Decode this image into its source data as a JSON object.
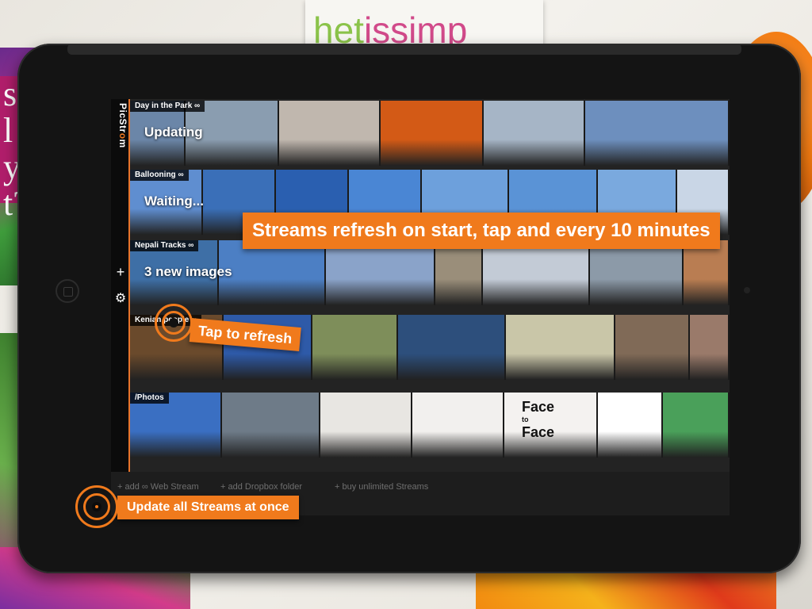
{
  "desk": {
    "card_text_a": "het",
    "card_text_b": "issimp",
    "book_text": "s\nl\ny\nt?"
  },
  "app": {
    "logo_prefix": "PicStr",
    "logo_o": "o",
    "logo_suffix": "m",
    "add_icon": "+",
    "settings_icon": "⚙",
    "accent": "#f07a1c"
  },
  "streams": [
    {
      "label": "Day in the Park ∞",
      "status": "Updating",
      "photos": [
        "#6b86a8",
        "#8a9db0",
        "#c0b7ae",
        "#d35a16",
        "#a6b5c6",
        "#6d8fbe"
      ]
    },
    {
      "label": "Ballooning ∞",
      "status": "Waiting...",
      "photos": [
        "#5f8ed0",
        "#3a6fb8",
        "#2a5fb0",
        "#4a86d4",
        "#6da0dc",
        "#5a93d6",
        "#7aa9de",
        "#c9d6e6"
      ]
    },
    {
      "label": "Nepali Tracks ∞",
      "status": "3 new images",
      "photos": [
        "#3e6fa6",
        "#4c7fc4",
        "#8aa3c9",
        "#9a8e7a",
        "#c3cbd6",
        "#8c9aa8",
        "#b97d52"
      ]
    },
    {
      "label": "Kenian people ∞",
      "status": "",
      "photos": [
        "#6a4a2c",
        "#2e5aa8",
        "#7e8e5a",
        "#2d4f7c",
        "#c9c6a8",
        "#806a57",
        "#9a7a6a"
      ]
    },
    {
      "label": "/Photos",
      "status": "",
      "photos": [
        "#3a6fc2",
        "#6e7b88",
        "#e8e6e2",
        "#f2f0ee",
        "#f4f2f0",
        "#ffffff",
        "#4aa05a",
        "#6c7a3c"
      ]
    }
  ],
  "bottom_links": {
    "web_stream": "+ add ∞ Web Stream",
    "dropbox": "+ add Dropbox folder",
    "buy": "+ buy unlimited Streams"
  },
  "face_card": {
    "line1": "Face",
    "line2": "to",
    "line3": "Face"
  },
  "callouts": {
    "main": "Streams refresh on start, tap and every 10 minutes",
    "tap": "Tap to refresh",
    "update": "Update all Streams at once"
  }
}
